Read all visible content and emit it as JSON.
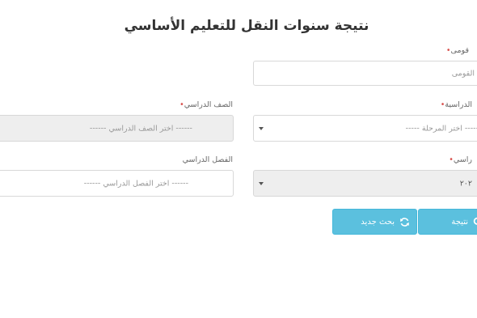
{
  "page": {
    "title": "نتيجة سنوات النقل للتعليم الأساسي"
  },
  "form": {
    "required_mark": "•",
    "national_id": {
      "label": "قومى",
      "placeholder": "القومى"
    },
    "stage": {
      "label": "الدراسية",
      "value": "----- اختر المرحلة -----"
    },
    "grade": {
      "label": "الصف الدراسي",
      "value": "------ اختر الصف الدراسي ------"
    },
    "year": {
      "label": "راسي",
      "value": "٢٠٢"
    },
    "class": {
      "label": "الفصل الدراسي",
      "value": "------ اختر الفصل الدراسي ------"
    }
  },
  "buttons": {
    "search_label": "نتيجة",
    "new_search_label": "بحث جديد"
  },
  "icons": {
    "search": "search-icon",
    "refresh": "refresh-icon"
  },
  "colors": {
    "button_bg": "#5bc0de",
    "required": "#d9534f",
    "disabled_bg": "#eeeeee"
  }
}
